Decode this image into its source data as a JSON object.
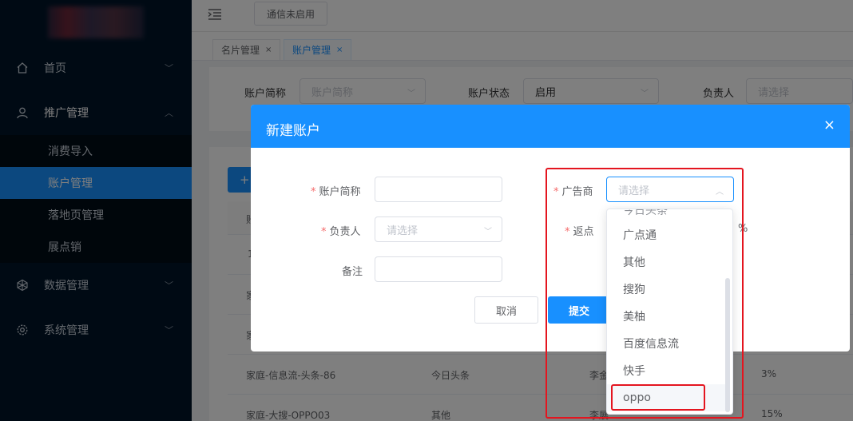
{
  "sidebar": {
    "menu": [
      {
        "label": "首页",
        "icon": "home-icon"
      },
      {
        "label": "推广管理",
        "icon": "user-icon"
      },
      {
        "label": "数据管理",
        "icon": "data-icon"
      },
      {
        "label": "系统管理",
        "icon": "gear-icon"
      }
    ],
    "submenu": [
      "消费导入",
      "账户管理",
      "落地页管理",
      "展点销"
    ]
  },
  "topbar": {
    "comm_status": "通信未启用"
  },
  "tabs": [
    {
      "label": "名片管理",
      "close": "×"
    },
    {
      "label": "账户管理",
      "close": "×"
    }
  ],
  "filter": {
    "account_label": "账户简称",
    "account_placeholder": "账户简称",
    "status_label": "账户状态",
    "status_value": "启用",
    "owner_label": "负责人",
    "owner_placeholder": "请选择"
  },
  "table": {
    "add_label": "+",
    "header_first": "账",
    "partial_cells": [
      "1",
      "家",
      "家"
    ],
    "rows": [
      {
        "name": "家庭-信息流-头条-86",
        "advertiser": "今日头条",
        "owner": "李金",
        "rebate": "3%"
      },
      {
        "name": "家庭-大搜-OPPO03",
        "advertiser": "其他",
        "owner": "李展",
        "rebate": "15%"
      }
    ]
  },
  "dialog": {
    "title": "新建账户",
    "close": "×",
    "required_mark": "*",
    "fields": {
      "account_label": "账户简称",
      "owner_label": "负责人",
      "owner_placeholder": "请选择",
      "remark_label": "备注",
      "advertiser_label": "广告商",
      "advertiser_placeholder": "请选择",
      "rebate_label": "返点",
      "rebate_unit": "%"
    },
    "cancel": "取消",
    "submit": "提交"
  },
  "dropdown": {
    "cut_off_option": "今日头条",
    "options": [
      "广点通",
      "其他",
      "搜狗",
      "美柚",
      "百度信息流",
      "快手",
      "oppo"
    ],
    "highlighted": "oppo"
  },
  "colors": {
    "primary": "#1890ff",
    "sidebar": "#001529",
    "highlight_box": "#e4151f"
  }
}
